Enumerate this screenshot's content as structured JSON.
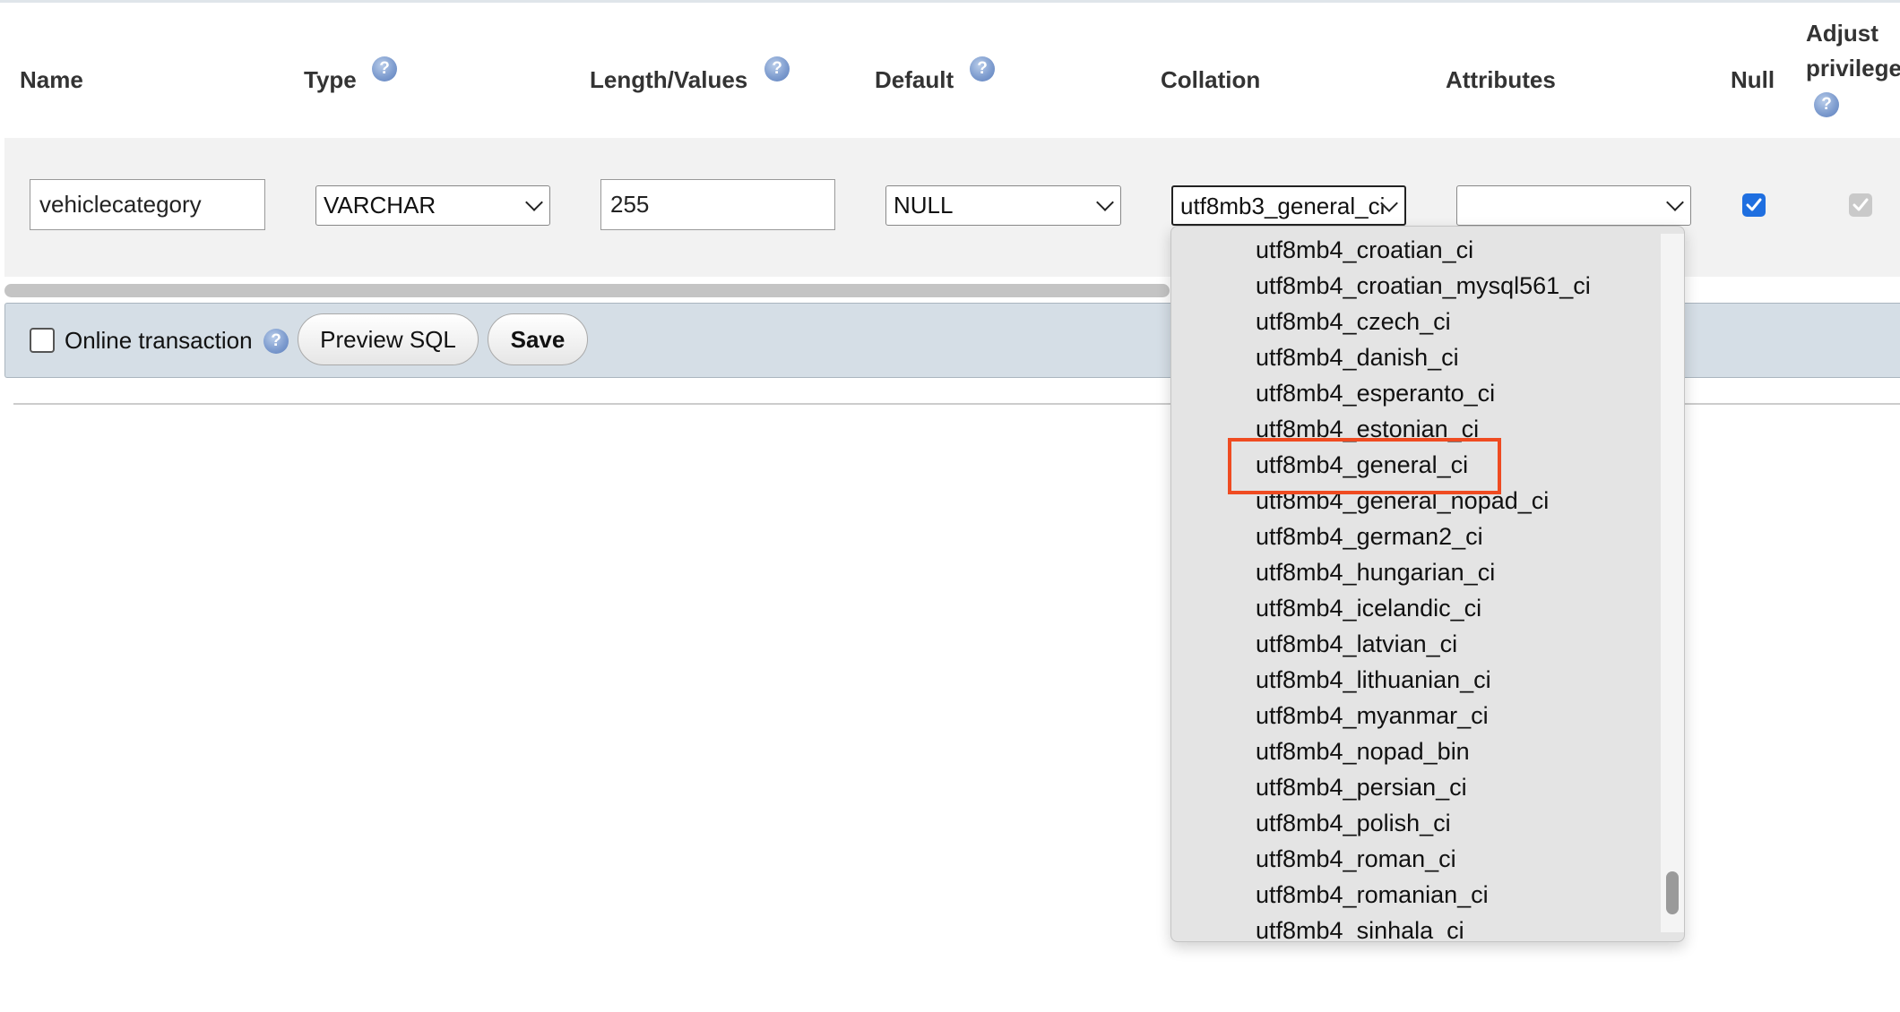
{
  "header": {
    "name": "Name",
    "type": "Type",
    "length": "Length/Values",
    "default": "Default",
    "collation": "Collation",
    "attributes": "Attributes",
    "null": "Null",
    "adjust_line1": "Adjust",
    "adjust_line2": "privilege",
    "help_glyph": "?"
  },
  "row": {
    "name_value": "vehiclecategory",
    "type_value": "VARCHAR",
    "length_value": "255",
    "default_value": "NULL",
    "collation_value": "utf8mb3_general_ci",
    "attributes_value": "",
    "null_checked": true,
    "adjust_checked": true
  },
  "footer": {
    "online_transaction": "Online transaction",
    "preview_sql": "Preview SQL",
    "save": "Save"
  },
  "collation_options": [
    "utf8mb4_croatian_ci",
    "utf8mb4_croatian_mysql561_ci",
    "utf8mb4_czech_ci",
    "utf8mb4_danish_ci",
    "utf8mb4_esperanto_ci",
    "utf8mb4_estonian_ci",
    "utf8mb4_general_ci",
    "utf8mb4_general_nopad_ci",
    "utf8mb4_german2_ci",
    "utf8mb4_hungarian_ci",
    "utf8mb4_icelandic_ci",
    "utf8mb4_latvian_ci",
    "utf8mb4_lithuanian_ci",
    "utf8mb4_myanmar_ci",
    "utf8mb4_nopad_bin",
    "utf8mb4_persian_ci",
    "utf8mb4_polish_ci",
    "utf8mb4_roman_ci",
    "utf8mb4_romanian_ci",
    "utf8mb4_sinhala_ci"
  ],
  "highlighted_option": "utf8mb4_general_ci",
  "colors": {
    "highlight_border": "#ef4b21",
    "checkbox_blue": "#1f6fe0",
    "footer_bg": "#d5dee6"
  }
}
